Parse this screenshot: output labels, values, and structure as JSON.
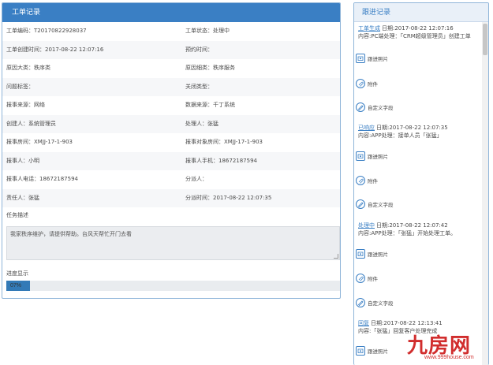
{
  "left_panel": {
    "title": "工单记录",
    "fields": [
      [
        "工单编码：T20170822928037",
        "工单状态：处理中"
      ],
      [
        "工单创建时间：2017-08-22 12:07:16",
        "预约时间："
      ],
      [
        "原因大类：秩序类",
        "原因细类：秩序服务"
      ],
      [
        "问题标签：",
        "关闭类型："
      ],
      [
        "报事来源：网络",
        "数据来源：千丁系统"
      ],
      [
        "创建人：系统管理员",
        "处理人：张猛"
      ],
      [
        "报事房间：XMJJ-17-1-903",
        "报事对象房间：XMJJ-17-1-903"
      ],
      [
        "报事人：小明",
        "报事人手机：18672187594"
      ],
      [
        "报事人电话：18672187594",
        "分派人："
      ],
      [
        "责任人：张猛",
        "分派时间：2017-08-22 12:07:35"
      ]
    ],
    "task_title": "任务描述",
    "task_text": "我家秩序维护，请提供帮助。台风天帮忙开门去看",
    "progress_title": "进度显示",
    "progress_label": "07%",
    "progress_value": 0.07
  },
  "right_panel": {
    "title": "跟进记录",
    "entries": [
      {
        "status": "工单生成",
        "line1": "日期:2017-08-22 12:07:16",
        "line2": "内容:PC端处理：「CRM超级管理员」创建工单"
      },
      {
        "status": "已响应",
        "line1": "日期:2017-08-22 12:07:35",
        "line2": "内容:APP处理：接单人员「张猛」"
      },
      {
        "status": "处理中",
        "line1": "日期:2017-08-22 12:07:42",
        "line2": "内容:APP处理：「张猛」开始处理工单。"
      },
      {
        "status": "回复",
        "line1": "日期:2017-08-22 12:13:41",
        "line2": "内容:「张猛」回复客户处理完成"
      }
    ],
    "action_labels": {
      "photo": "跟进照片",
      "attach": "附件",
      "custom": "自定义字段"
    }
  },
  "watermark": {
    "logo": "九房网",
    "url": "www.999house.com"
  }
}
